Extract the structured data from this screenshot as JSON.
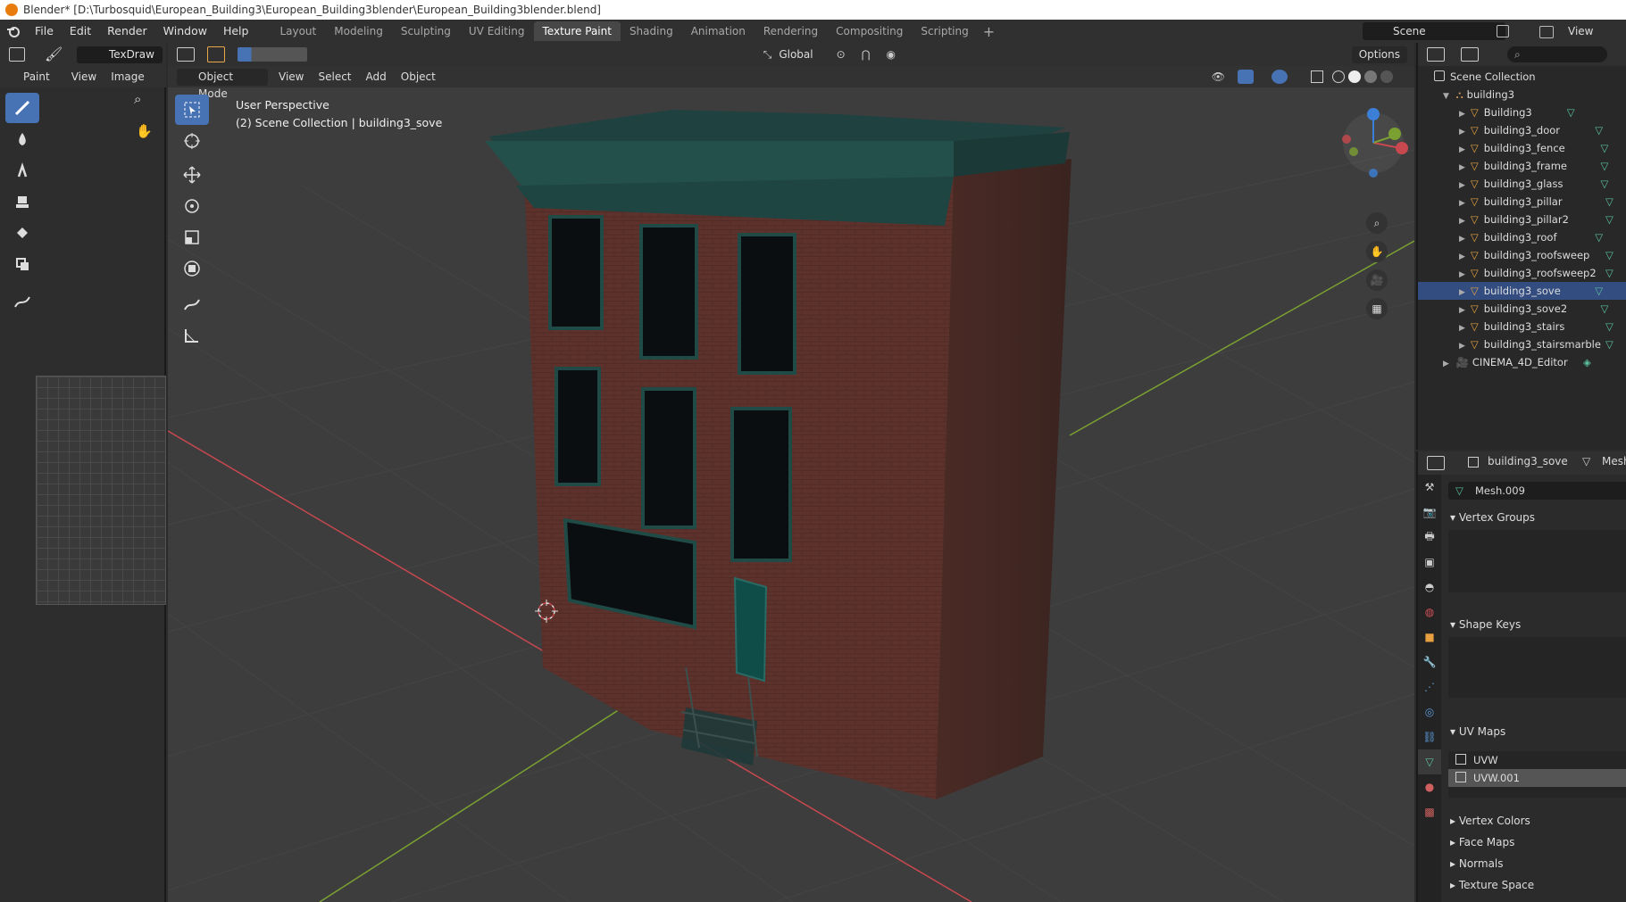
{
  "window_title": "Blender* [D:\\Turbosquid\\European_Building3\\European_Building3blender\\European_Building3blender.blend]",
  "menu": [
    "File",
    "Edit",
    "Render",
    "Window",
    "Help"
  ],
  "workspaces": [
    "Layout",
    "Modeling",
    "Sculpting",
    "UV Editing",
    "Texture Paint",
    "Shading",
    "Animation",
    "Rendering",
    "Compositing",
    "Scripting"
  ],
  "active_workspace": "Texture Paint",
  "scene": "Scene",
  "view_layer": "View Layer",
  "image_editor": {
    "texture_name": "TexDraw",
    "menus": [
      "Paint",
      "View",
      "Image"
    ]
  },
  "viewport": {
    "mode": "Object Mode",
    "menus": [
      "View",
      "Select",
      "Add",
      "Object"
    ],
    "orientation": "Global",
    "options_label": "Options",
    "view_name": "User Perspective",
    "collection_info": "(2) Scene Collection | building3_sove"
  },
  "outliner": {
    "root": "Scene Collection",
    "collection": "building3",
    "objects": [
      "Building3",
      "building3_door",
      "building3_fence",
      "building3_frame",
      "building3_glass",
      "building3_pillar",
      "building3_pillar2",
      "building3_roof",
      "building3_roofsweep",
      "building3_roofsweep2",
      "building3_sove",
      "building3_sove2",
      "building3_stairs",
      "building3_stairsmarble"
    ],
    "selected": "building3_sove",
    "camera": "CINEMA_4D_Editor"
  },
  "properties": {
    "object": "building3_sove",
    "data_type": "Mesh",
    "mesh_name": "Mesh.009",
    "sections": {
      "vertex_groups": "Vertex Groups",
      "shape_keys": "Shape Keys",
      "uv_maps": "UV Maps",
      "vertex_colors": "Vertex Colors",
      "face_maps": "Face Maps",
      "normals": "Normals",
      "texture_space": "Texture Space"
    },
    "uv_maps": [
      "UVW",
      "UVW.001"
    ],
    "active_uv": "UVW.001"
  },
  "colors": {
    "accent": "#4772b3",
    "brick": "#6e3a32",
    "trim": "#1f4a46",
    "axis_x": "#c8484f",
    "axis_y": "#7aa032"
  }
}
